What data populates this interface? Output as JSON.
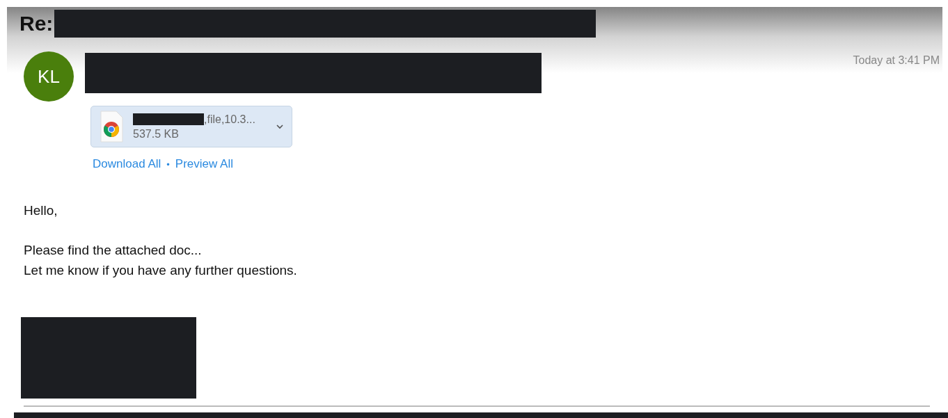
{
  "header": {
    "subject_prefix": "Re:",
    "sender_initials": "KL",
    "timestamp": "Today at 3:41 PM"
  },
  "attachment": {
    "name_suffix": ",file,10.3...",
    "size": "537.5 KB"
  },
  "attachment_links": [
    {
      "label": "Download All"
    },
    {
      "label": "Preview All"
    }
  ],
  "link_separator": "•",
  "body": {
    "greeting": "Hello,",
    "lines": [
      "Please find the attached doc...",
      "Let me know if you have any further questions."
    ]
  }
}
